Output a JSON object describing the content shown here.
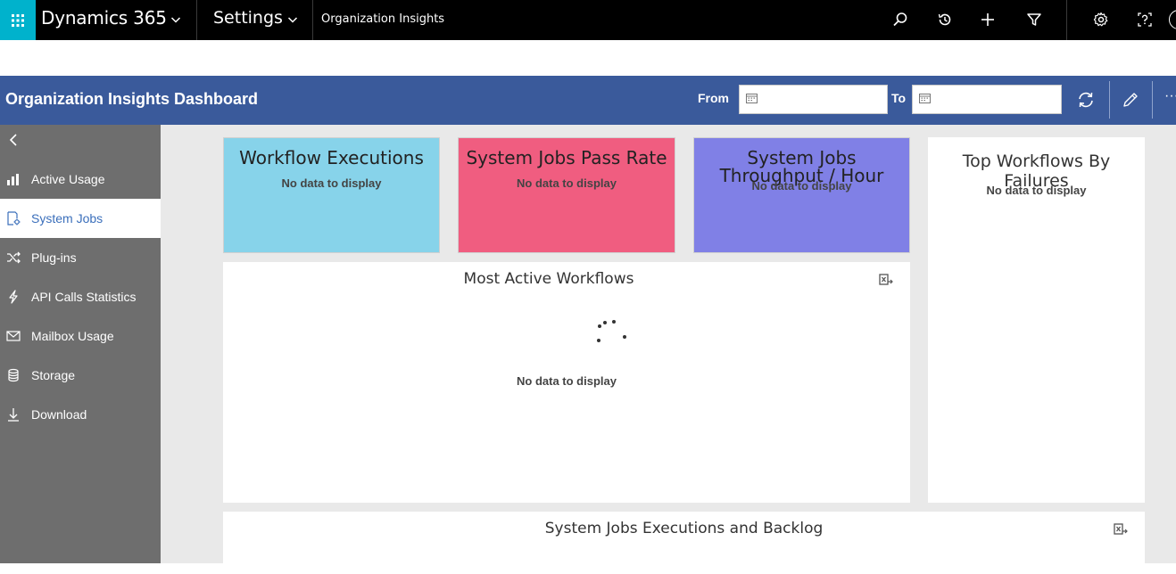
{
  "topbar": {
    "app_name": "Dynamics 365",
    "area_name": "Settings",
    "breadcrumb": "Organization Insights",
    "accent": "#00b2cc"
  },
  "header": {
    "title": "Organization Insights Dashboard",
    "from_label": "From",
    "to_label": "To",
    "from_value": "",
    "to_value": "",
    "more_label": "···",
    "background": "#3a5a9b"
  },
  "sidebar": {
    "items": [
      {
        "label": "Active Usage",
        "icon": "bar-chart-icon"
      },
      {
        "label": "System Jobs",
        "icon": "system-jobs-icon"
      },
      {
        "label": "Plug-ins",
        "icon": "shuffle-icon"
      },
      {
        "label": "API Calls Statistics",
        "icon": "lightning-icon"
      },
      {
        "label": "Mailbox Usage",
        "icon": "mail-icon"
      },
      {
        "label": "Storage",
        "icon": "database-icon"
      },
      {
        "label": "Download",
        "icon": "download-icon"
      }
    ],
    "active_index": 1
  },
  "tiles": [
    {
      "title": "Workflow Executions",
      "empty": "No data to display",
      "color": "#87d3ea"
    },
    {
      "title": "System Jobs Pass Rate",
      "empty": "No data to display",
      "color": "#f05d80"
    },
    {
      "title": "System Jobs Throughput / Hour",
      "empty": "No data to display",
      "color": "#8080e6"
    }
  ],
  "panels": {
    "top_failures": {
      "title": "Top Workflows By Failures",
      "empty": "No data to display"
    },
    "most_active": {
      "title": "Most Active Workflows",
      "empty": "No data to display"
    },
    "executions_backlog": {
      "title": "System Jobs Executions and Backlog"
    }
  }
}
